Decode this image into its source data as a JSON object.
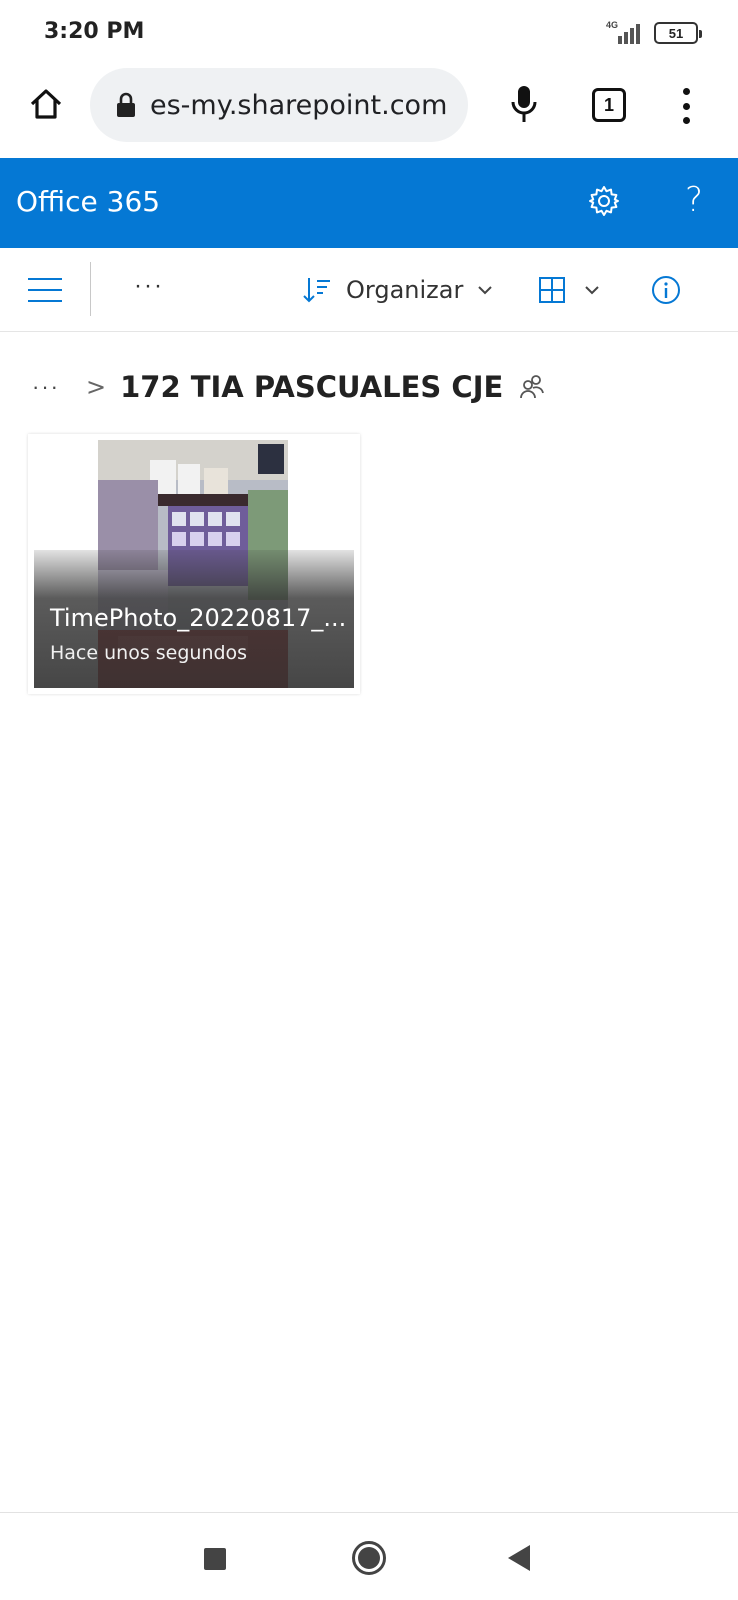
{
  "status_bar": {
    "time": "3:20 PM",
    "network": "4G",
    "battery": "51"
  },
  "browser": {
    "url": "es-my.sharepoint.com",
    "tab_count": "1",
    "icons": [
      "home-icon",
      "lock-icon",
      "microphone-icon",
      "tabs-icon",
      "overflow-menu-icon"
    ]
  },
  "header": {
    "title": "Office 365",
    "help_glyph": "?",
    "color": "#0578d4",
    "icons": [
      "gear-icon",
      "help-icon"
    ]
  },
  "command_bar": {
    "more_glyph": "···",
    "sort_label": "Organizar",
    "accent": "#0578d4",
    "icons": [
      "hamburger-icon",
      "sort-icon",
      "chevron-down-icon",
      "grid-view-icon",
      "info-icon"
    ]
  },
  "breadcrumb": {
    "more_glyph": "···",
    "separator": ">",
    "folder_title": "172 TIA PASCUALES CJE",
    "icons": [
      "shared-people-icon"
    ]
  },
  "files": [
    {
      "name": "TimePhoto_20220817_...",
      "modified": "Hace unos segundos",
      "thumbnail": "store-shelf-photo"
    }
  ],
  "nav_bar": {
    "icons": [
      "recents-square-icon",
      "home-circle-icon",
      "back-triangle-icon"
    ]
  }
}
